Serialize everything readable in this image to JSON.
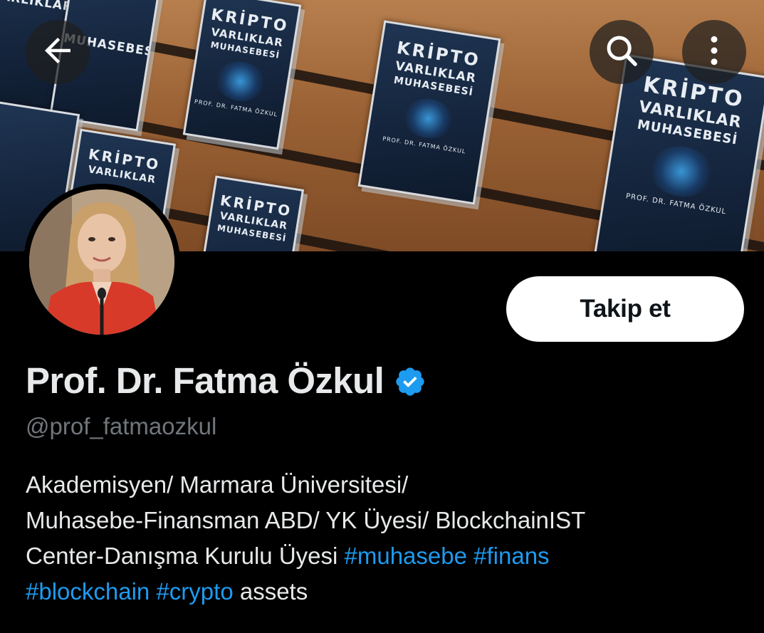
{
  "header": {
    "back_icon": "arrow-left-icon",
    "search_icon": "search-icon",
    "more_icon": "more-vertical-icon"
  },
  "banner": {
    "book_title_line1": "KRİPTO",
    "book_title_line2": "VARLIKLAR",
    "book_title_line3": "MUHASEBESİ",
    "book_author": "PROF. DR. FATMA ÖZKUL"
  },
  "profile": {
    "follow_label": "Takip et",
    "display_name": "Prof. Dr. Fatma Özkul",
    "handle": "@prof_fatmaozkul",
    "bio": {
      "line1": "Akademisyen/ Marmara Üniversitesi/",
      "line2": "Muhasebe-Finansman ABD/ YK Üyesi/ BlockchainIST",
      "line3_text": "Center-Danışma Kurulu Üyesi ",
      "tag1": "#muhasebe",
      "tag2": "#finans",
      "tag3": "#blockchain",
      "tag4": "#crypto",
      "tail": " assets"
    }
  },
  "colors": {
    "background": "#000000",
    "link": "#1d9bf0",
    "verified": "#1d9bf0",
    "text": "#e7e9ea",
    "muted": "#71767b"
  }
}
